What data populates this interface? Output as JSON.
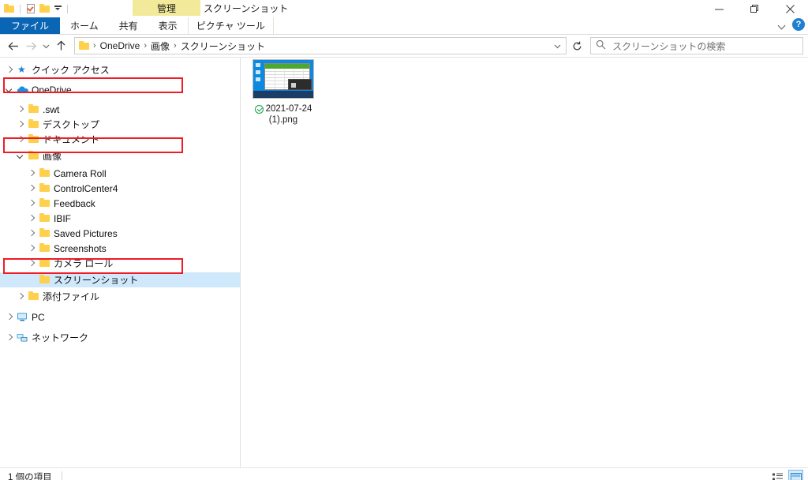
{
  "window": {
    "title": "スクリーンショット",
    "contextual_tab_group": "管理",
    "controls": {
      "minimize": "minimize-icon",
      "maximize": "restore-icon",
      "close": "close-icon"
    }
  },
  "quick_access_toolbar": {
    "items": [
      {
        "name": "folder-icon"
      },
      {
        "name": "properties-icon"
      },
      {
        "name": "new-folder-icon"
      },
      {
        "name": "customize-dropdown-icon"
      }
    ]
  },
  "ribbon": {
    "tabs": [
      {
        "label": "ファイル",
        "active": true,
        "style": "file"
      },
      {
        "label": "ホーム",
        "active": false,
        "style": "normal"
      },
      {
        "label": "共有",
        "active": false,
        "style": "normal"
      },
      {
        "label": "表示",
        "active": false,
        "style": "normal"
      },
      {
        "label": "ピクチャ ツール",
        "active": false,
        "style": "contextual"
      }
    ],
    "collapse_icon": "chevron-down-icon",
    "help_icon": "help-icon",
    "help_label": "?"
  },
  "navigation": {
    "back": "back-arrow-icon",
    "forward": "forward-arrow-icon",
    "recent": "recent-locations-chevron-icon",
    "up": "up-arrow-icon",
    "refresh": "refresh-icon",
    "address_dropdown": "chevron-down-icon"
  },
  "address_bar": {
    "folder_icon": "folder-icon",
    "breadcrumbs": [
      "OneDrive",
      "画像",
      "スクリーンショット"
    ],
    "separator": "›"
  },
  "search": {
    "icon": "search-icon",
    "placeholder": "スクリーンショットの検索"
  },
  "nav_pane": {
    "items": [
      {
        "label": "クイック アクセス",
        "indent": 0,
        "twisty": "collapsed",
        "icon": "star-icon",
        "selected": false,
        "highlighted": false
      },
      {
        "label": "OneDrive",
        "indent": 0,
        "twisty": "expanded",
        "icon": "cloud-icon",
        "selected": false,
        "highlighted": true
      },
      {
        "label": ".swt",
        "indent": 1,
        "twisty": "collapsed",
        "icon": "folder-icon",
        "selected": false,
        "highlighted": false
      },
      {
        "label": "デスクトップ",
        "indent": 1,
        "twisty": "collapsed",
        "icon": "folder-icon",
        "selected": false,
        "highlighted": false
      },
      {
        "label": "ドキュメント",
        "indent": 1,
        "twisty": "collapsed",
        "icon": "folder-icon",
        "selected": false,
        "highlighted": false
      },
      {
        "label": "画像",
        "indent": 1,
        "twisty": "expanded",
        "icon": "folder-icon",
        "selected": false,
        "highlighted": true
      },
      {
        "label": "Camera Roll",
        "indent": 2,
        "twisty": "collapsed",
        "icon": "folder-icon",
        "selected": false,
        "highlighted": false
      },
      {
        "label": "ControlCenter4",
        "indent": 2,
        "twisty": "collapsed",
        "icon": "folder-icon",
        "selected": false,
        "highlighted": false
      },
      {
        "label": "Feedback",
        "indent": 2,
        "twisty": "collapsed",
        "icon": "folder-icon",
        "selected": false,
        "highlighted": false
      },
      {
        "label": "IBIF",
        "indent": 2,
        "twisty": "collapsed",
        "icon": "folder-icon",
        "selected": false,
        "highlighted": false
      },
      {
        "label": "Saved Pictures",
        "indent": 2,
        "twisty": "collapsed",
        "icon": "folder-icon",
        "selected": false,
        "highlighted": false
      },
      {
        "label": "Screenshots",
        "indent": 2,
        "twisty": "collapsed",
        "icon": "folder-icon",
        "selected": false,
        "highlighted": false
      },
      {
        "label": "カメラ ロール",
        "indent": 2,
        "twisty": "collapsed",
        "icon": "folder-icon",
        "selected": false,
        "highlighted": false
      },
      {
        "label": "スクリーンショット",
        "indent": 2,
        "twisty": "none",
        "icon": "folder-icon",
        "selected": true,
        "highlighted": true
      },
      {
        "label": "添付ファイル",
        "indent": 1,
        "twisty": "collapsed",
        "icon": "folder-icon",
        "selected": false,
        "highlighted": false
      },
      {
        "label": "PC",
        "indent": 0,
        "twisty": "collapsed",
        "icon": "pc-icon",
        "selected": false,
        "highlighted": false
      },
      {
        "label": "ネットワーク",
        "indent": 0,
        "twisty": "collapsed",
        "icon": "network-icon",
        "selected": false,
        "highlighted": false
      }
    ]
  },
  "files": [
    {
      "name_line1": "2021-07-24",
      "name_line2": "(1).png",
      "sync_status_icon": "onedrive-synced-check-icon",
      "thumbnail": "spreadsheet-screenshot-thumbnail"
    }
  ],
  "status_bar": {
    "item_count_text": "1 個の項目",
    "view_buttons": [
      {
        "name": "details-view-button",
        "active": false
      },
      {
        "name": "large-icons-view-button",
        "active": true
      }
    ]
  },
  "annotations": {
    "color": "#ee1c25",
    "boxes": [
      {
        "target": "OneDrive"
      },
      {
        "target": "画像"
      },
      {
        "target": "スクリーンショット"
      }
    ]
  }
}
